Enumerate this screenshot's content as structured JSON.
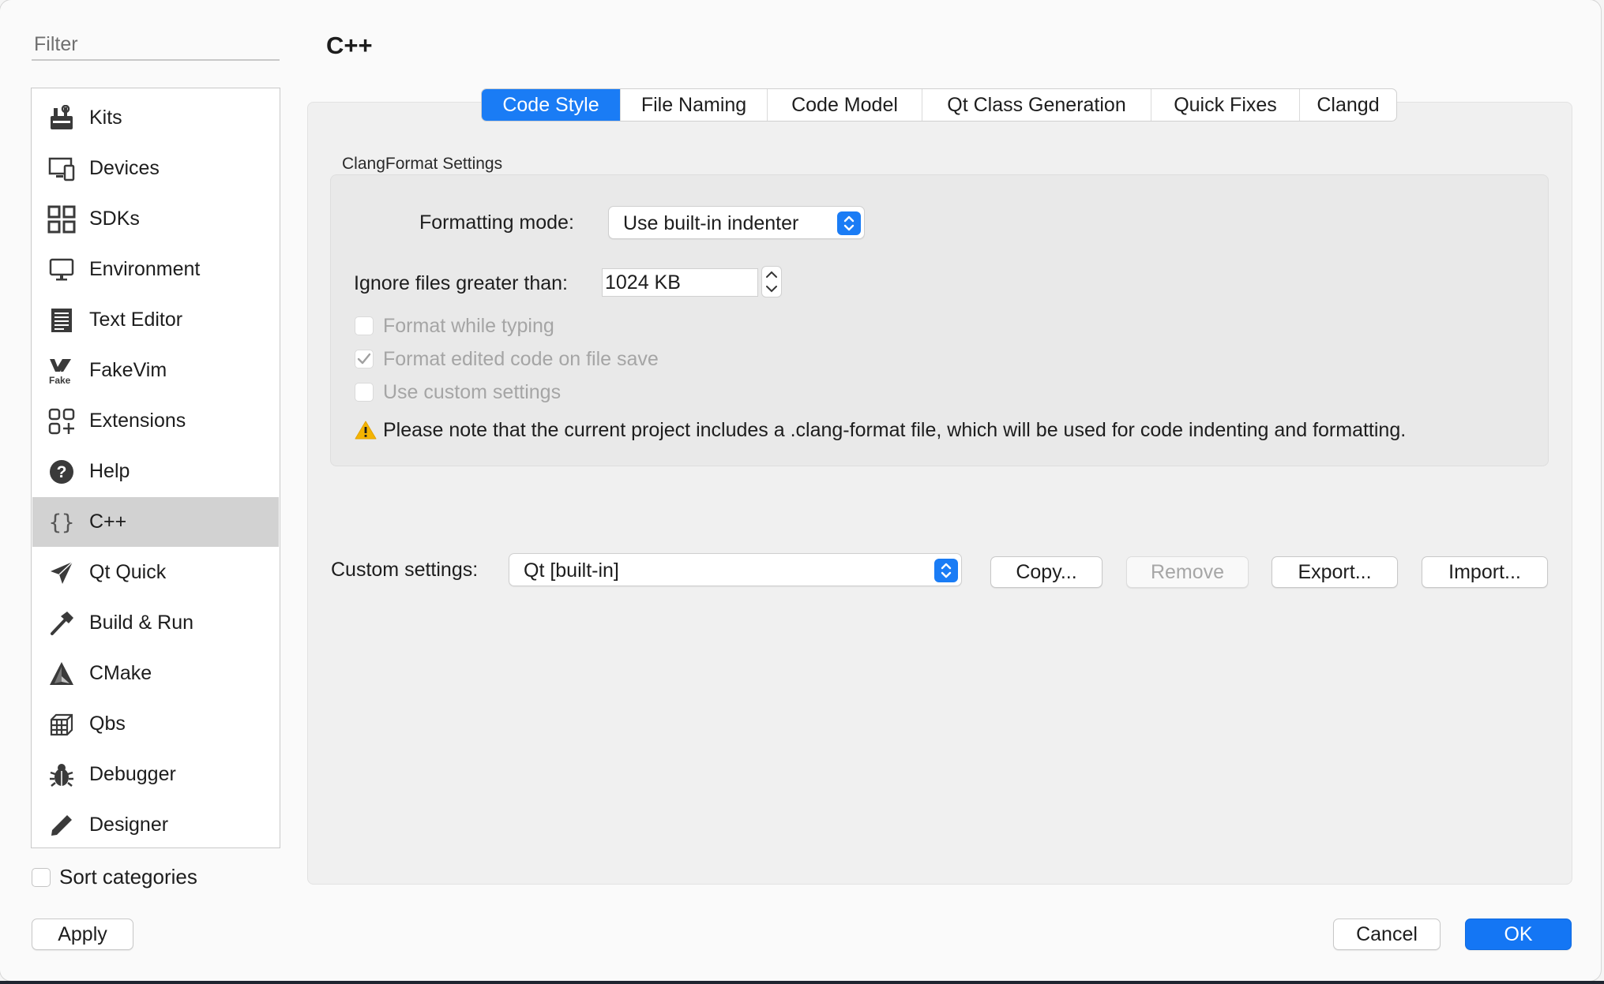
{
  "filter": {
    "placeholder": "Filter"
  },
  "sidebar": {
    "items": [
      {
        "label": "Kits",
        "icon": "kits-icon"
      },
      {
        "label": "Devices",
        "icon": "devices-icon"
      },
      {
        "label": "SDKs",
        "icon": "sdks-icon"
      },
      {
        "label": "Environment",
        "icon": "environment-icon"
      },
      {
        "label": "Text Editor",
        "icon": "text-editor-icon"
      },
      {
        "label": "FakeVim",
        "icon": "fakevim-icon"
      },
      {
        "label": "Extensions",
        "icon": "extensions-icon"
      },
      {
        "label": "Help",
        "icon": "help-icon"
      },
      {
        "label": "C++",
        "icon": "braces-icon",
        "selected": true
      },
      {
        "label": "Qt Quick",
        "icon": "qt-quick-icon"
      },
      {
        "label": "Build & Run",
        "icon": "hammer-icon"
      },
      {
        "label": "CMake",
        "icon": "cmake-icon"
      },
      {
        "label": "Qbs",
        "icon": "qbs-icon"
      },
      {
        "label": "Debugger",
        "icon": "bug-icon"
      },
      {
        "label": "Designer",
        "icon": "pencil-icon"
      }
    ],
    "sort_label": "Sort categories",
    "sort_checked": false
  },
  "page": {
    "title": "C++"
  },
  "tabs": [
    {
      "label": "Code Style",
      "active": true
    },
    {
      "label": "File Naming"
    },
    {
      "label": "Code Model"
    },
    {
      "label": "Qt Class Generation"
    },
    {
      "label": "Quick Fixes"
    },
    {
      "label": "Clangd"
    }
  ],
  "clangformat": {
    "group_title": "ClangFormat Settings",
    "formatting_mode_label": "Formatting mode:",
    "formatting_mode_value": "Use built-in indenter",
    "ignore_label": "Ignore files greater than:",
    "ignore_value": "1024 KB",
    "format_while_typing": {
      "label": "Format while typing",
      "checked": false
    },
    "format_on_save": {
      "label": "Format edited code on file save",
      "checked": true
    },
    "use_custom": {
      "label": "Use custom settings",
      "checked": false
    },
    "note": "Please note that the current project includes a .clang-format file, which will be used for code indenting and formatting."
  },
  "custom": {
    "label": "Custom settings:",
    "value": "Qt [built-in]",
    "copy": "Copy...",
    "remove": "Remove",
    "export": "Export...",
    "import": "Import..."
  },
  "footer": {
    "apply": "Apply",
    "cancel": "Cancel",
    "ok": "OK"
  },
  "colors": {
    "accent": "#1a7cf5",
    "selected_row": "#d2d2d2",
    "warning": "#f4b400"
  }
}
